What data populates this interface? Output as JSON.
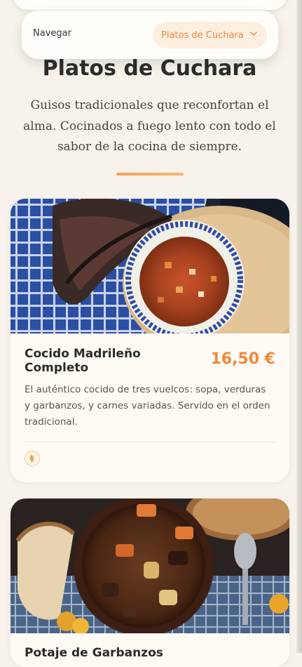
{
  "nav": {
    "label": "Navegar",
    "selected_category": "Platos de Cuchara",
    "dropdown_icon": "chevron-down-icon"
  },
  "header": {
    "title": "Platos de Cuchara",
    "subtitle": "Guisos tradicionales que reconfortan el alma. Cocinados a fuego lento con todo el sabor de la cocina de siempre."
  },
  "dishes": [
    {
      "name": "Cocido Madrileño Completo",
      "price": "16,50 €",
      "description": "El auténtico cocido de tres vuelcos: sopa, verduras y garbanzos, y carnes variadas. Servido en el orden tradicional.",
      "image": "cocido-stew-photo",
      "allergen_icon": "wheat-icon"
    },
    {
      "name": "Potaje de Garbanzos",
      "image": "beef-stew-photo"
    }
  ],
  "colors": {
    "accent": "#ef8a3d",
    "background": "#f7f3ec",
    "card": "#fffbf4"
  }
}
